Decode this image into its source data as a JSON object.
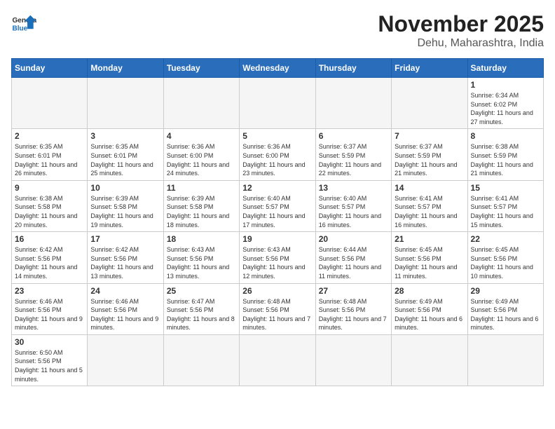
{
  "logo": {
    "text_general": "General",
    "text_blue": "Blue"
  },
  "title": {
    "month_year": "November 2025",
    "location": "Dehu, Maharashtra, India"
  },
  "weekdays": [
    "Sunday",
    "Monday",
    "Tuesday",
    "Wednesday",
    "Thursday",
    "Friday",
    "Saturday"
  ],
  "weeks": [
    [
      {
        "day": "",
        "info": ""
      },
      {
        "day": "",
        "info": ""
      },
      {
        "day": "",
        "info": ""
      },
      {
        "day": "",
        "info": ""
      },
      {
        "day": "",
        "info": ""
      },
      {
        "day": "",
        "info": ""
      },
      {
        "day": "1",
        "info": "Sunrise: 6:34 AM\nSunset: 6:02 PM\nDaylight: 11 hours\nand 27 minutes."
      }
    ],
    [
      {
        "day": "2",
        "info": "Sunrise: 6:35 AM\nSunset: 6:01 PM\nDaylight: 11 hours\nand 26 minutes."
      },
      {
        "day": "3",
        "info": "Sunrise: 6:35 AM\nSunset: 6:01 PM\nDaylight: 11 hours\nand 25 minutes."
      },
      {
        "day": "4",
        "info": "Sunrise: 6:36 AM\nSunset: 6:00 PM\nDaylight: 11 hours\nand 24 minutes."
      },
      {
        "day": "5",
        "info": "Sunrise: 6:36 AM\nSunset: 6:00 PM\nDaylight: 11 hours\nand 23 minutes."
      },
      {
        "day": "6",
        "info": "Sunrise: 6:37 AM\nSunset: 5:59 PM\nDaylight: 11 hours\nand 22 minutes."
      },
      {
        "day": "7",
        "info": "Sunrise: 6:37 AM\nSunset: 5:59 PM\nDaylight: 11 hours\nand 21 minutes."
      },
      {
        "day": "8",
        "info": "Sunrise: 6:38 AM\nSunset: 5:59 PM\nDaylight: 11 hours\nand 21 minutes."
      }
    ],
    [
      {
        "day": "9",
        "info": "Sunrise: 6:38 AM\nSunset: 5:58 PM\nDaylight: 11 hours\nand 20 minutes."
      },
      {
        "day": "10",
        "info": "Sunrise: 6:39 AM\nSunset: 5:58 PM\nDaylight: 11 hours\nand 19 minutes."
      },
      {
        "day": "11",
        "info": "Sunrise: 6:39 AM\nSunset: 5:58 PM\nDaylight: 11 hours\nand 18 minutes."
      },
      {
        "day": "12",
        "info": "Sunrise: 6:40 AM\nSunset: 5:57 PM\nDaylight: 11 hours\nand 17 minutes."
      },
      {
        "day": "13",
        "info": "Sunrise: 6:40 AM\nSunset: 5:57 PM\nDaylight: 11 hours\nand 16 minutes."
      },
      {
        "day": "14",
        "info": "Sunrise: 6:41 AM\nSunset: 5:57 PM\nDaylight: 11 hours\nand 16 minutes."
      },
      {
        "day": "15",
        "info": "Sunrise: 6:41 AM\nSunset: 5:57 PM\nDaylight: 11 hours\nand 15 minutes."
      }
    ],
    [
      {
        "day": "16",
        "info": "Sunrise: 6:42 AM\nSunset: 5:56 PM\nDaylight: 11 hours\nand 14 minutes."
      },
      {
        "day": "17",
        "info": "Sunrise: 6:42 AM\nSunset: 5:56 PM\nDaylight: 11 hours\nand 13 minutes."
      },
      {
        "day": "18",
        "info": "Sunrise: 6:43 AM\nSunset: 5:56 PM\nDaylight: 11 hours\nand 13 minutes."
      },
      {
        "day": "19",
        "info": "Sunrise: 6:43 AM\nSunset: 5:56 PM\nDaylight: 11 hours\nand 12 minutes."
      },
      {
        "day": "20",
        "info": "Sunrise: 6:44 AM\nSunset: 5:56 PM\nDaylight: 11 hours\nand 11 minutes."
      },
      {
        "day": "21",
        "info": "Sunrise: 6:45 AM\nSunset: 5:56 PM\nDaylight: 11 hours\nand 11 minutes."
      },
      {
        "day": "22",
        "info": "Sunrise: 6:45 AM\nSunset: 5:56 PM\nDaylight: 11 hours\nand 10 minutes."
      }
    ],
    [
      {
        "day": "23",
        "info": "Sunrise: 6:46 AM\nSunset: 5:56 PM\nDaylight: 11 hours\nand 9 minutes."
      },
      {
        "day": "24",
        "info": "Sunrise: 6:46 AM\nSunset: 5:56 PM\nDaylight: 11 hours\nand 9 minutes."
      },
      {
        "day": "25",
        "info": "Sunrise: 6:47 AM\nSunset: 5:56 PM\nDaylight: 11 hours\nand 8 minutes."
      },
      {
        "day": "26",
        "info": "Sunrise: 6:48 AM\nSunset: 5:56 PM\nDaylight: 11 hours\nand 7 minutes."
      },
      {
        "day": "27",
        "info": "Sunrise: 6:48 AM\nSunset: 5:56 PM\nDaylight: 11 hours\nand 7 minutes."
      },
      {
        "day": "28",
        "info": "Sunrise: 6:49 AM\nSunset: 5:56 PM\nDaylight: 11 hours\nand 6 minutes."
      },
      {
        "day": "29",
        "info": "Sunrise: 6:49 AM\nSunset: 5:56 PM\nDaylight: 11 hours\nand 6 minutes."
      }
    ],
    [
      {
        "day": "30",
        "info": "Sunrise: 6:50 AM\nSunset: 5:56 PM\nDaylight: 11 hours\nand 5 minutes."
      },
      {
        "day": "",
        "info": ""
      },
      {
        "day": "",
        "info": ""
      },
      {
        "day": "",
        "info": ""
      },
      {
        "day": "",
        "info": ""
      },
      {
        "day": "",
        "info": ""
      },
      {
        "day": "",
        "info": ""
      }
    ]
  ]
}
